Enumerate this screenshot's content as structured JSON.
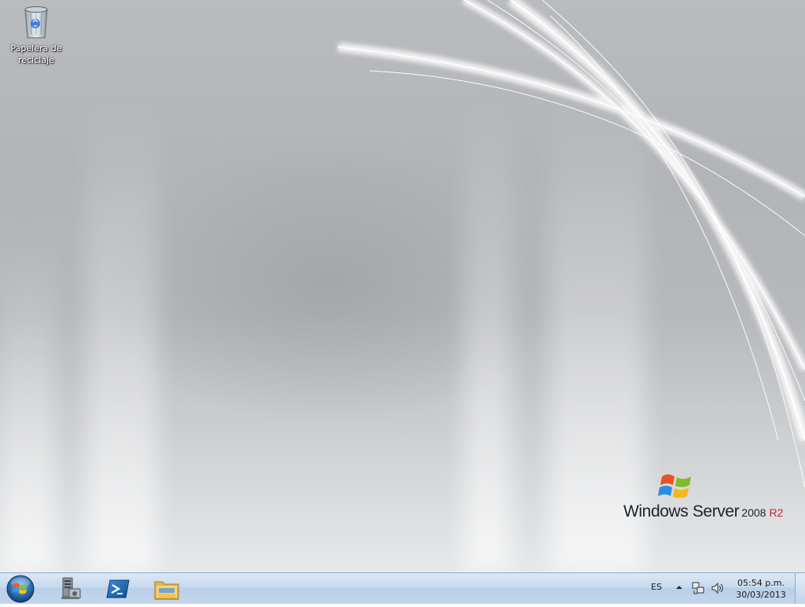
{
  "desktop": {
    "icons": [
      {
        "name": "recycle-bin-icon",
        "label": "Papelera de\nreciclaje"
      }
    ],
    "brand": {
      "product": "Windows Server",
      "version": "2008",
      "edition": "R2",
      "edition_color": "#d0202a"
    }
  },
  "taskbar": {
    "start_icon": "windows-orb-icon",
    "pinned": [
      {
        "name": "server-manager-icon"
      },
      {
        "name": "powershell-icon"
      },
      {
        "name": "file-explorer-icon"
      }
    ],
    "tray": {
      "language": "ES",
      "icons": [
        "show-hidden-icons-chevron",
        "network-icon",
        "volume-icon"
      ]
    },
    "clock": {
      "time": "05:54 p.m.",
      "date": "30/03/2013"
    }
  }
}
